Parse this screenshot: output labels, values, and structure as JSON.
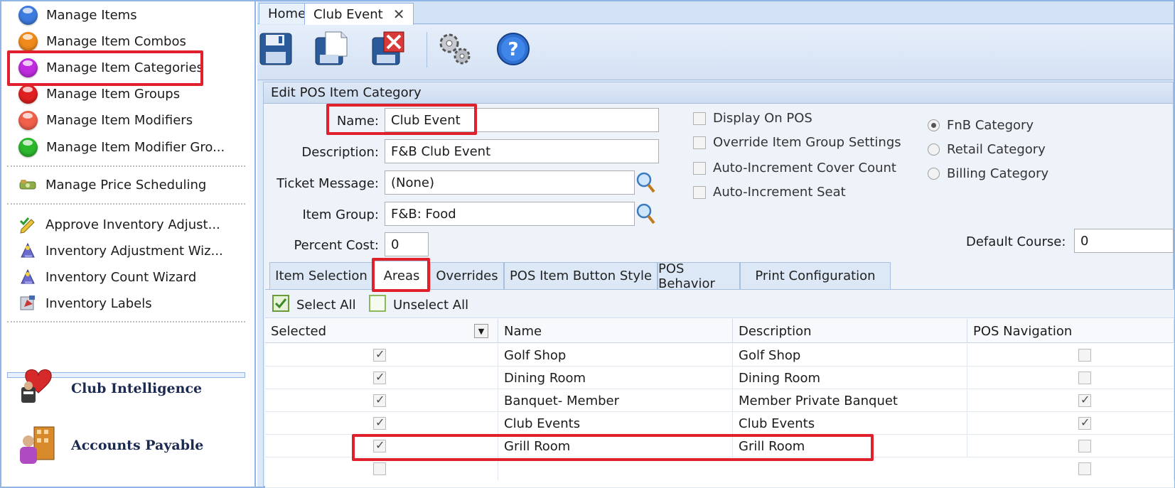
{
  "sidebar": {
    "items": [
      {
        "label": "Manage Items",
        "icon": "blue-orb-icon",
        "color": "#3d7be0"
      },
      {
        "label": "Manage Item Combos",
        "icon": "orange-orb-icon",
        "color": "#f08a1c"
      },
      {
        "label": "Manage Item Categories",
        "icon": "purple-orb-icon",
        "color": "#c02be0"
      },
      {
        "label": "Manage Item Groups",
        "icon": "red-orb-icon",
        "color": "#e02020"
      },
      {
        "label": "Manage Item Modifiers",
        "icon": "salmon-orb-icon",
        "color": "#f0604a"
      },
      {
        "label": "Manage Item Modifier Gro...",
        "icon": "green-orb-icon",
        "color": "#2cb82c"
      },
      {
        "label": "Manage Price Scheduling",
        "icon": "money-icon"
      },
      {
        "label": "Approve Inventory Adjust...",
        "icon": "approve-pencil-icon"
      },
      {
        "label": "Inventory Adjustment Wiz...",
        "icon": "wizard-icon"
      },
      {
        "label": "Inventory Count Wizard",
        "icon": "wizard-icon"
      },
      {
        "label": "Inventory Labels",
        "icon": "labels-icon"
      }
    ],
    "modules": [
      {
        "label": "Club Intelligence",
        "icon": "club-intelligence-icon"
      },
      {
        "label": "Accounts Payable",
        "icon": "accounts-payable-icon"
      }
    ]
  },
  "tabs": {
    "home": "Home",
    "active": "Club Event"
  },
  "toolbar": {
    "buttons": [
      "save-icon",
      "save-new-icon",
      "delete-icon",
      "settings-icon",
      "help-icon"
    ]
  },
  "form": {
    "section_title": "Edit POS Item Category",
    "name_label": "Name:",
    "name_value": "Club Event",
    "description_label": "Description:",
    "description_value": "F&B Club Event",
    "ticket_label": "Ticket Message:",
    "ticket_value": "(None)",
    "group_label": "Item Group:",
    "group_value": "F&B: Food",
    "percent_label": "Percent Cost:",
    "percent_value": "0",
    "checkboxes": [
      "Display On POS",
      "Override Item Group Settings",
      "Auto-Increment Cover Count",
      "Auto-Increment Seat"
    ],
    "radios": [
      "FnB Category",
      "Retail Category",
      "Billing Category"
    ],
    "radio_selected": 0,
    "default_course_label": "Default Course:",
    "default_course_value": "0"
  },
  "subtabs": [
    "Item Selection",
    "Areas",
    "Overrides",
    "POS Item Button Style",
    "POS Behavior",
    "Print Configuration"
  ],
  "grid": {
    "select_all": "Select All",
    "unselect_all": "Unselect All",
    "headers": [
      "Selected",
      "Name",
      "Description",
      "POS Navigation"
    ],
    "rows": [
      {
        "selected": true,
        "name": "Golf Shop",
        "description": "Golf Shop",
        "pos_nav": false
      },
      {
        "selected": true,
        "name": "Dining Room",
        "description": "Dining Room",
        "pos_nav": false
      },
      {
        "selected": true,
        "name": "Banquet- Member",
        "description": "Member Private Banquet",
        "pos_nav": true
      },
      {
        "selected": true,
        "name": "Club Events",
        "description": "Club Events",
        "pos_nav": true
      },
      {
        "selected": true,
        "name": "Grill Room",
        "description": "Grill Room",
        "pos_nav": false
      }
    ]
  },
  "highlight_color": "#e0202a"
}
